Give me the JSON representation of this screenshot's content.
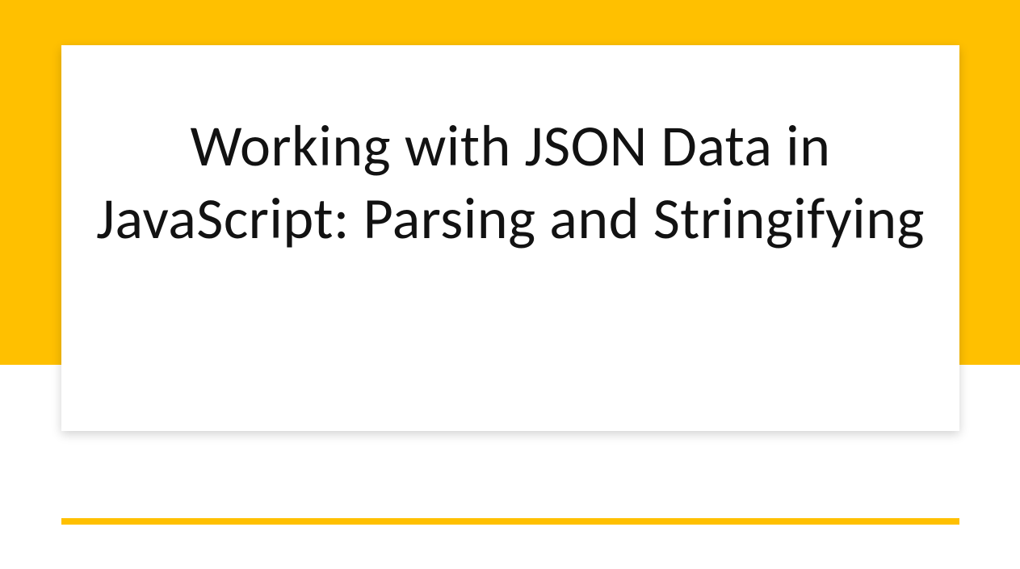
{
  "slide": {
    "title": "Working with JSON Data in JavaScript: Parsing and Stringifying"
  },
  "colors": {
    "accent": "#FFC000",
    "text": "#121212",
    "background": "#FFFFFF"
  }
}
